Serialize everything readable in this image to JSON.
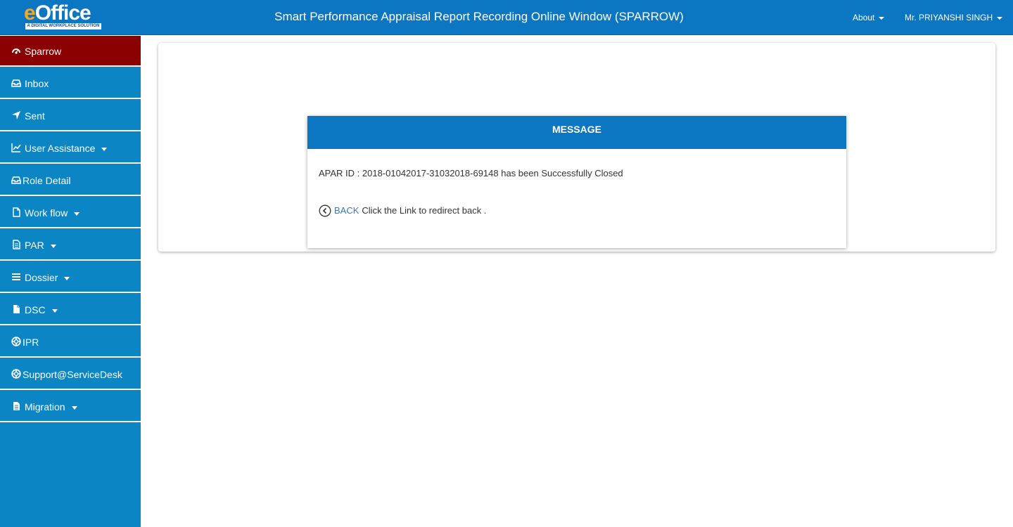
{
  "header": {
    "logo_e": "e",
    "logo_rest": "Office",
    "logo_tagline": "A DIGITAL WORKPLACE SOLUTION",
    "title": "Smart Performance Appraisal Report Recording Online Window (SPARROW)",
    "about_label": "About",
    "user_label": "Mr. PRIYANSHI SINGH"
  },
  "sidebar": {
    "items": [
      {
        "label": "Sparrow",
        "icon": "dashboard-icon",
        "active": true
      },
      {
        "label": "Inbox",
        "icon": "inbox-icon"
      },
      {
        "label": "Sent",
        "icon": "send-icon"
      },
      {
        "label": "User Assistance",
        "icon": "line-chart-icon",
        "dropdown": true
      },
      {
        "label": "Role Detail",
        "icon": "inbox-icon"
      },
      {
        "label": "Work flow",
        "icon": "file-icon",
        "dropdown": true
      },
      {
        "label": "PAR",
        "icon": "file-text-icon",
        "dropdown": true
      },
      {
        "label": "Dossier",
        "icon": "list-icon",
        "dropdown": true
      },
      {
        "label": "DSC",
        "icon": "file-icon",
        "dropdown": true
      },
      {
        "label": "IPR",
        "icon": "lifebuoy-icon"
      },
      {
        "label": "Support@ServiceDesk",
        "icon": "lifebuoy-icon"
      },
      {
        "label": "Migration",
        "icon": "file-text-icon",
        "dropdown": true
      }
    ]
  },
  "message": {
    "heading": "MESSAGE",
    "text": "APAR ID : 2018-01042017-31032018-69148 has been Successfully Closed",
    "back_label": "BACK",
    "back_suffix": "Click the Link to redirect back ."
  },
  "colors": {
    "header_bg": "#0b77c2",
    "sidebar_bg": "#0b85c4",
    "active_bg": "#8b0000",
    "link": "#337ab7"
  }
}
